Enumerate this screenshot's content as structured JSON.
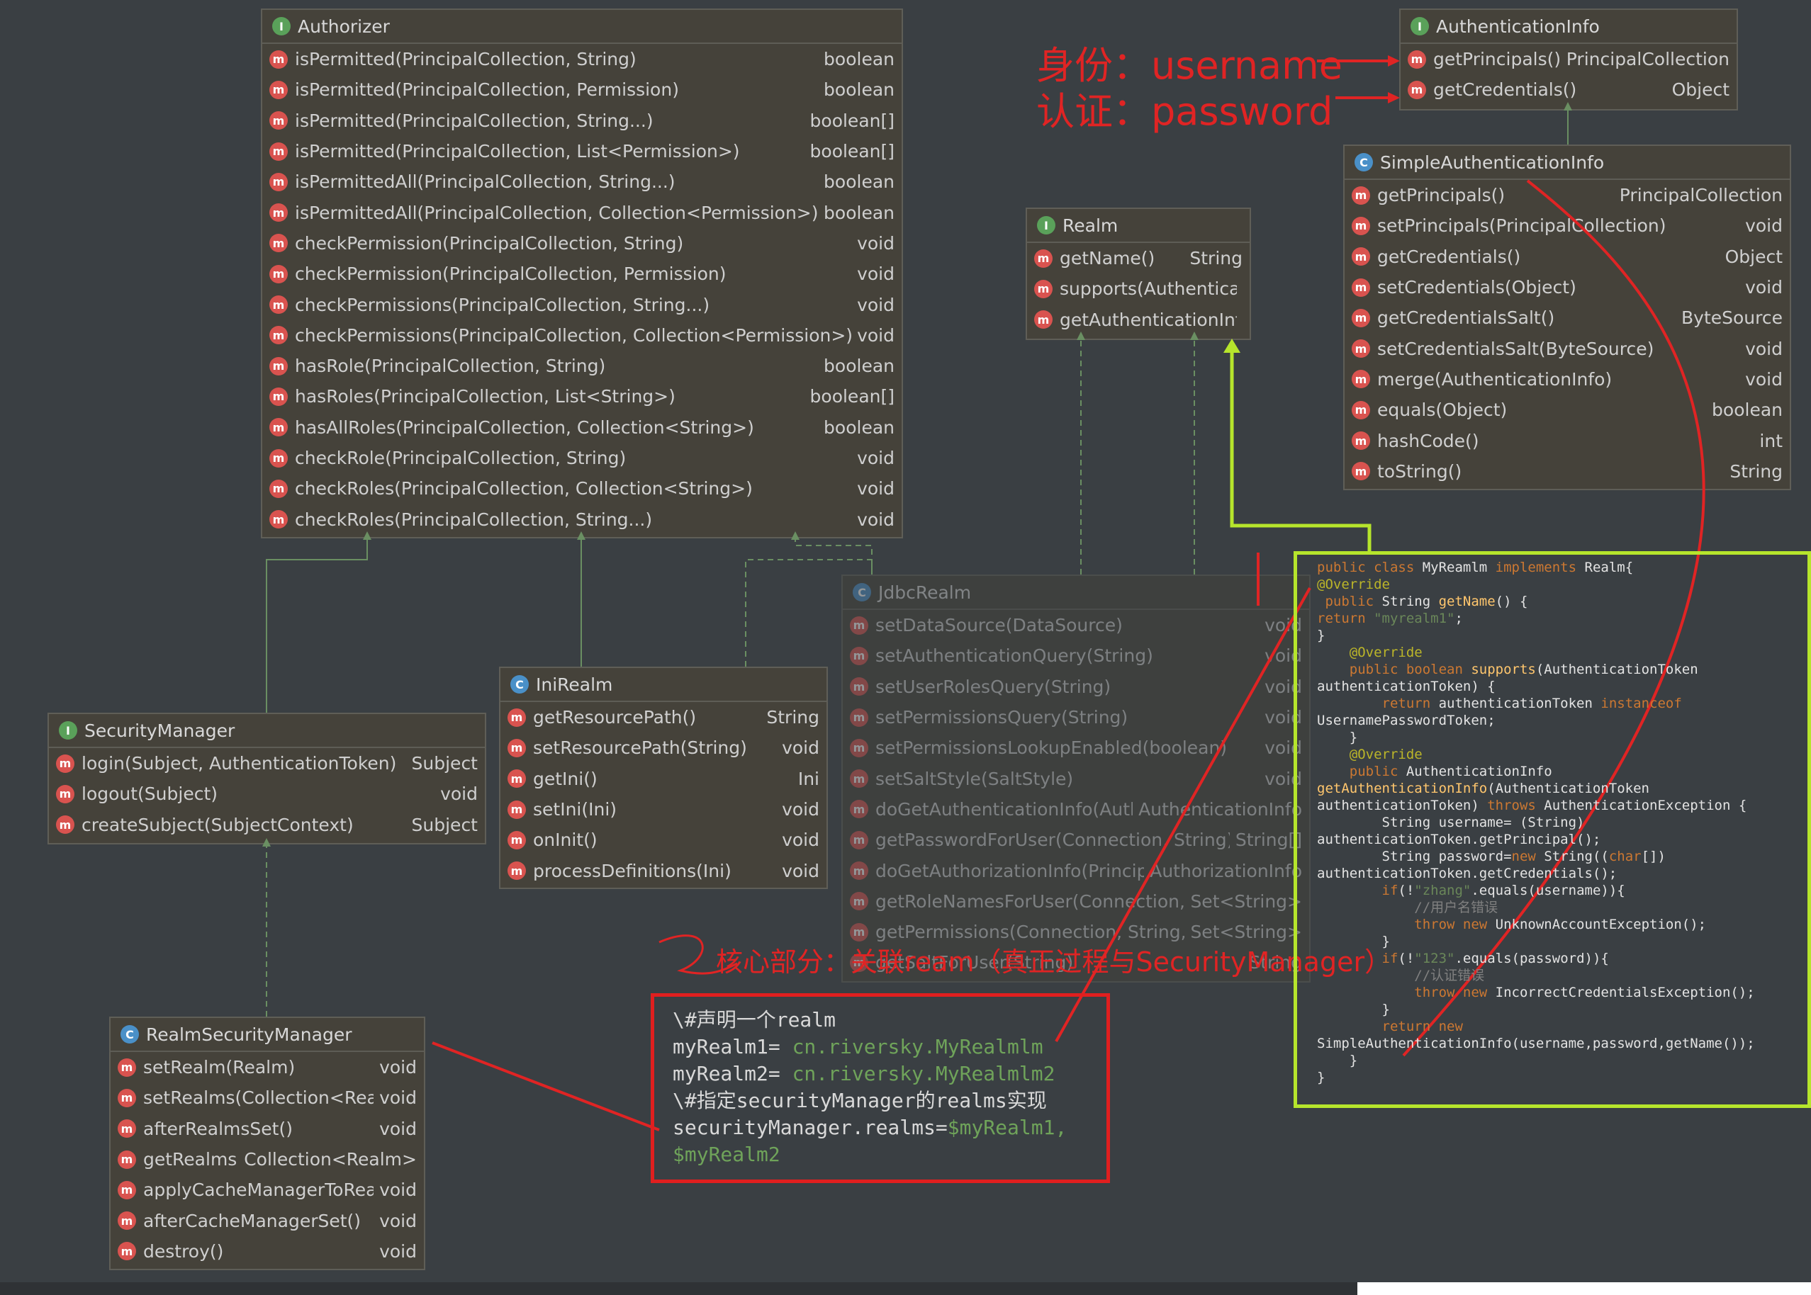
{
  "authorizer": {
    "title": "Authorizer",
    "methods": [
      {
        "name": "isPermitted(PrincipalCollection, String)",
        "type": "boolean"
      },
      {
        "name": "isPermitted(PrincipalCollection, Permission)",
        "type": "boolean"
      },
      {
        "name": "isPermitted(PrincipalCollection, String...)",
        "type": "boolean[]"
      },
      {
        "name": "isPermitted(PrincipalCollection, List<Permission>)",
        "type": "boolean[]"
      },
      {
        "name": "isPermittedAll(PrincipalCollection, String...)",
        "type": "boolean"
      },
      {
        "name": "isPermittedAll(PrincipalCollection, Collection<Permission>)",
        "type": "boolean"
      },
      {
        "name": "checkPermission(PrincipalCollection, String)",
        "type": "void"
      },
      {
        "name": "checkPermission(PrincipalCollection, Permission)",
        "type": "void"
      },
      {
        "name": "checkPermissions(PrincipalCollection, String...)",
        "type": "void"
      },
      {
        "name": "checkPermissions(PrincipalCollection, Collection<Permission>)",
        "type": "void"
      },
      {
        "name": "hasRole(PrincipalCollection, String)",
        "type": "boolean"
      },
      {
        "name": "hasRoles(PrincipalCollection, List<String>)",
        "type": "boolean[]"
      },
      {
        "name": "hasAllRoles(PrincipalCollection, Collection<String>)",
        "type": "boolean"
      },
      {
        "name": "checkRole(PrincipalCollection, String)",
        "type": "void"
      },
      {
        "name": "checkRoles(PrincipalCollection, Collection<String>)",
        "type": "void"
      },
      {
        "name": "checkRoles(PrincipalCollection, String...)",
        "type": "void"
      }
    ]
  },
  "realm": {
    "title": "Realm",
    "methods": [
      {
        "name": "getName()",
        "type": "String"
      },
      {
        "name": "supports(AuthenticationToken)",
        "type": ""
      },
      {
        "name": "getAuthenticationInfo(AuthenticationToken)",
        "type": ""
      }
    ]
  },
  "authentication_info": {
    "title": "AuthenticationInfo",
    "methods": [
      {
        "name": "getPrincipals()",
        "type": "PrincipalCollection"
      },
      {
        "name": "getCredentials()",
        "type": "Object"
      }
    ]
  },
  "simple_authentication_info": {
    "title": "SimpleAuthenticationInfo",
    "methods": [
      {
        "name": "getPrincipals()",
        "type": "PrincipalCollection"
      },
      {
        "name": "setPrincipals(PrincipalCollection)",
        "type": "void"
      },
      {
        "name": "getCredentials()",
        "type": "Object"
      },
      {
        "name": "setCredentials(Object)",
        "type": "void"
      },
      {
        "name": "getCredentialsSalt()",
        "type": "ByteSource"
      },
      {
        "name": "setCredentialsSalt(ByteSource)",
        "type": "void"
      },
      {
        "name": "merge(AuthenticationInfo)",
        "type": "void"
      },
      {
        "name": "equals(Object)",
        "type": "boolean"
      },
      {
        "name": "hashCode()",
        "type": "int"
      },
      {
        "name": "toString()",
        "type": "String"
      }
    ]
  },
  "jdbc_realm": {
    "title": "JdbcRealm",
    "methods": [
      {
        "name": "setDataSource(DataSource)",
        "type": "void"
      },
      {
        "name": "setAuthenticationQuery(String)",
        "type": "void"
      },
      {
        "name": "setUserRolesQuery(String)",
        "type": "void"
      },
      {
        "name": "setPermissionsQuery(String)",
        "type": "void"
      },
      {
        "name": "setPermissionsLookupEnabled(boolean)",
        "type": "void"
      },
      {
        "name": "setSaltStyle(SaltStyle)",
        "type": "void"
      },
      {
        "name": "doGetAuthenticationInfo(AuthenticationToken)",
        "type": "AuthenticationInfo"
      },
      {
        "name": "getPasswordForUser(Connection, String)",
        "type": "String[]"
      },
      {
        "name": "doGetAuthorizationInfo(PrincipalCollection)",
        "type": "AuthorizationInfo"
      },
      {
        "name": "getRoleNamesForUser(Connection, String)",
        "type": "Set<String>"
      },
      {
        "name": "getPermissions(Connection, String, Collection<String>)",
        "type": "Set<String>"
      },
      {
        "name": "getSaltForUser(String)",
        "type": "String"
      }
    ]
  },
  "ini_realm": {
    "title": "IniRealm",
    "methods": [
      {
        "name": "getResourcePath()",
        "type": "String"
      },
      {
        "name": "setResourcePath(String)",
        "type": "void"
      },
      {
        "name": "getIni()",
        "type": "Ini"
      },
      {
        "name": "setIni(Ini)",
        "type": "void"
      },
      {
        "name": "onInit()",
        "type": "void"
      },
      {
        "name": "processDefinitions(Ini)",
        "type": "void"
      }
    ]
  },
  "security_manager": {
    "title": "SecurityManager",
    "methods": [
      {
        "name": "login(Subject, AuthenticationToken)",
        "type": "Subject"
      },
      {
        "name": "logout(Subject)",
        "type": "void"
      },
      {
        "name": "createSubject(SubjectContext)",
        "type": "Subject"
      }
    ]
  },
  "realm_security_manager": {
    "title": "RealmSecurityManager",
    "methods": [
      {
        "name": "setRealm(Realm)",
        "type": "void"
      },
      {
        "name": "setRealms(Collection<Realm>)",
        "type": "void"
      },
      {
        "name": "afterRealmsSet()",
        "type": "void"
      },
      {
        "name": "getRealms()",
        "type": "Collection<Realm>"
      },
      {
        "name": "applyCacheManagerToRealms()",
        "type": "void"
      },
      {
        "name": "afterCacheManagerSet()",
        "type": "void"
      },
      {
        "name": "destroy()",
        "type": "void"
      }
    ]
  },
  "annotations": {
    "identity_label": "身份：",
    "identity_value": "username",
    "auth_label": "认证：",
    "auth_value": "password",
    "core_part": "核心部分：关联ream（真正过程与SecurityManager）"
  },
  "ini_config": {
    "comment1": "\\#声明一个realm",
    "line1_key": "myRealm1= ",
    "line1_val": "cn.riversky.MyRealmlm",
    "line2_key": "myRealm2= ",
    "line2_val": "cn.riversky.MyRealmlm2",
    "comment2": "\\#指定securityManager的realms实现",
    "line3_key": "securityManager.realms=",
    "line3_val": "$myRealm1,",
    "line4_val": "$myRealm2"
  },
  "code": {
    "l1_kw": "public class ",
    "l1_name": "MyReamlm ",
    "l1_kw2": "implements ",
    "l1_end": "Realm{",
    "l2": "@Override",
    "l3_kw": " public ",
    "l3_type": "String ",
    "l3_fn": "getName",
    "l3_end": "() {",
    "l4_kw": "return ",
    "l4_str": "\"myrealm1\"",
    "l4_end": ";",
    "l5": "}",
    "l6": "    @Override",
    "l7_kw": "    public boolean ",
    "l7_fn": "supports",
    "l7_end": "(AuthenticationToken",
    "l8": "authenticationToken) {",
    "l9_kw": "        return ",
    "l9_mid": "authenticationToken ",
    "l9_kw2": "instanceof",
    "l10": "UsernamePasswordToken;",
    "l11": "    }",
    "l12": "    @Override",
    "l13_kw": "    public ",
    "l13_end": "AuthenticationInfo",
    "l14_fn": "getAuthenticationInfo",
    "l14_end": "(AuthenticationToken",
    "l15_a": "authenticationToken) ",
    "l15_kw": "throws ",
    "l15_end": "AuthenticationException {",
    "l16": "        String username= (String)",
    "l17": "authenticationToken.getPrincipal();",
    "l18_a": "        String password=",
    "l18_kw": "new ",
    "l18_b": "String((",
    "l18_kw2": "char",
    "l18_end": "[])",
    "l19": "authenticationToken.getCredentials();",
    "l20_kw": "        if",
    "l20_a": "(!",
    "l20_str": "\"zhang\"",
    "l20_end": ".equals(username)){",
    "l21": "            //用户名错误",
    "l22_kw": "            throw new ",
    "l22_end": "UnknownAccountException();",
    "l23": "        }",
    "l24_kw": "        if",
    "l24_a": "(!",
    "l24_str": "\"123\"",
    "l24_end": ".equals(password)){",
    "l25": "            //认证错误",
    "l26_kw": "            throw new ",
    "l26_end": "IncorrectCredentialsException();",
    "l27": "        }",
    "l28_kw": "        return new",
    "l29": "SimpleAuthenticationInfo(username,password,getName());",
    "l30": "    }",
    "l31": "}"
  },
  "colors": {
    "background": "#3a3f43",
    "box": "#45423a",
    "annotation_red": "#e02424",
    "highlight_green": "#b6e52c"
  }
}
